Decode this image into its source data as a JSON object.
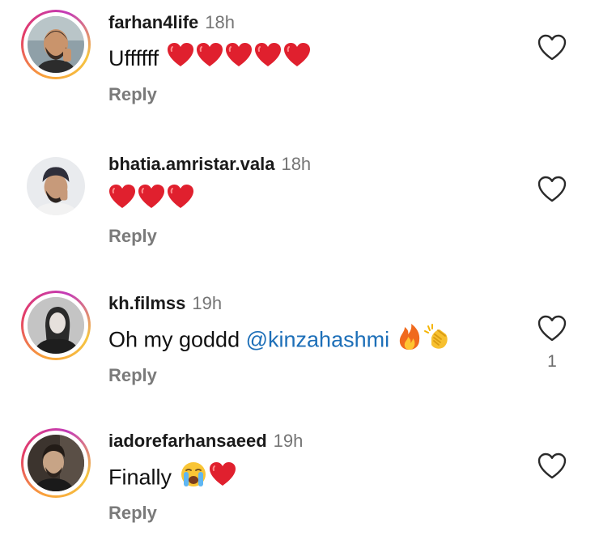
{
  "comments": [
    {
      "username": "farhan4life",
      "time": "18h",
      "text": "Uffffff",
      "emojis": [
        "red-heart",
        "red-heart",
        "red-heart",
        "red-heart",
        "red-heart"
      ],
      "reply_label": "Reply",
      "story_ring": true
    },
    {
      "username": "bhatia.amristar.vala",
      "time": "18h",
      "text": "",
      "emojis": [
        "red-heart",
        "red-heart",
        "red-heart"
      ],
      "reply_label": "Reply",
      "story_ring": false
    },
    {
      "username": "kh.filmss",
      "time": "19h",
      "text": "Oh my goddd",
      "mention": "@kinzahashmi",
      "emojis": [
        "fire",
        "clapping-hands"
      ],
      "reply_label": "Reply",
      "like_count": "1",
      "story_ring": true
    },
    {
      "username": "iadorefarhansaeed",
      "time": "19h",
      "text": "Finally",
      "emojis": [
        "loudly-crying-face",
        "red-heart"
      ],
      "reply_label": "Reply",
      "story_ring": true
    }
  ],
  "icons": {
    "like": "heart-outline-icon"
  },
  "colors": {
    "mention": "#1d6fb8",
    "heart": "#e0202e",
    "muted_text": "#757575"
  }
}
